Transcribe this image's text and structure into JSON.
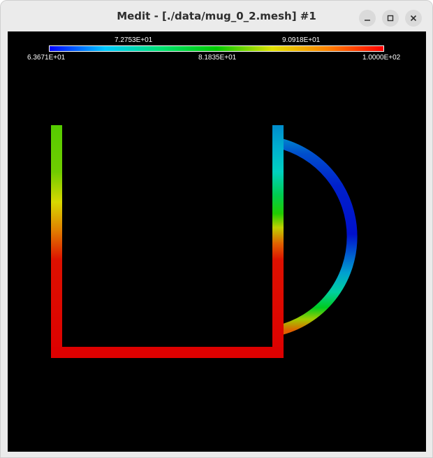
{
  "window": {
    "title": "Medit - [./data/mug_0_2.mesh] #1",
    "controls": {
      "minimize": "minimize-icon",
      "maximize": "maximize-icon",
      "close": "close-icon"
    }
  },
  "colorbar": {
    "min_label": "6.3671E+01",
    "mid_label": "8.1835E+01",
    "max_label": "1.0000E+02",
    "upper_left_label": "7.2753E+01",
    "upper_right_label": "9.0918E+01",
    "min_value": 63.671,
    "max_value": 100.0,
    "colors": [
      "#0000ff",
      "#00c8ff",
      "#00e070",
      "#00c800",
      "#e0e000",
      "#ff8000",
      "#ff0000"
    ]
  },
  "colors": {
    "background": "#000000",
    "titlebar": "#ebebeb",
    "button": "#dadada"
  }
}
